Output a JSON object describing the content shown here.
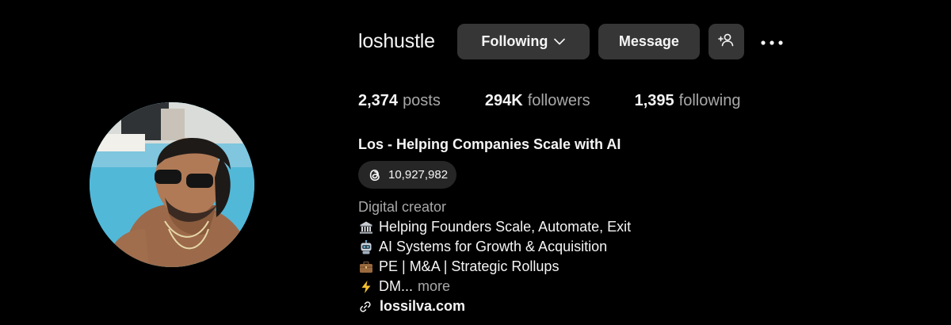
{
  "profile": {
    "username": "loshustle",
    "following_label": "Following",
    "message_label": "Message",
    "stats": {
      "posts_count": "2,374",
      "posts_label": "posts",
      "followers_count": "294K",
      "followers_label": "followers",
      "following_count": "1,395",
      "following_label": "following"
    },
    "full_name": "Los - Helping Companies Scale with AI",
    "threads_count": "10,927,982",
    "category": "Digital creator",
    "bio_lines": [
      {
        "icon": "bank-emoji-icon",
        "text": "Helping Founders Scale, Automate, Exit"
      },
      {
        "icon": "robot-emoji-icon",
        "text": "AI Systems for Growth & Acquisition"
      },
      {
        "icon": "briefcase-emoji-icon",
        "text": "PE | M&A | Strategic Rollups"
      },
      {
        "icon": "lightning-emoji-icon",
        "text": "DM..."
      }
    ],
    "more_label": "more",
    "website": "lossilva.com"
  },
  "colors": {
    "background": "#000000",
    "button_bg": "#363636",
    "pill_bg": "#262626",
    "text_primary": "#f5f5f5",
    "text_secondary": "#a8a8a8"
  }
}
